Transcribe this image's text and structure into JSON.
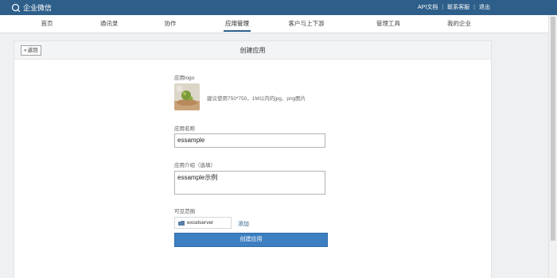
{
  "topbar": {
    "brand": "企业微信",
    "links": [
      "API文档",
      "联系客服",
      "退出"
    ]
  },
  "nav": {
    "items": [
      "首页",
      "通讯录",
      "协作",
      "应用管理",
      "客户与上下游",
      "管理工具",
      "我的企业"
    ],
    "active_index": 3
  },
  "page": {
    "back_label": "返回",
    "title": "创建应用"
  },
  "form": {
    "logo_label": "应用logo",
    "logo_hint": "建议使用750*750，1M以内的jpg、png图片",
    "name_label": "应用名称",
    "name_value": "essample",
    "desc_label": "应用介绍（选填）",
    "desc_value": "essample示例",
    "scope_label": "可见范围",
    "scope_tag": "excelserver",
    "add_link": "添加",
    "submit_label": "创建应用"
  },
  "colors": {
    "topbar": "#2e5f8a",
    "primary_button": "#3d7fc0"
  }
}
